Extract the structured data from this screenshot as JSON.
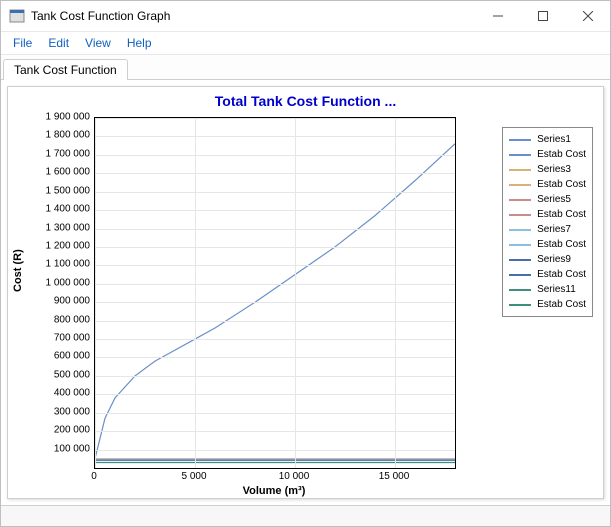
{
  "window": {
    "title": "Tank Cost Function Graph"
  },
  "menubar": {
    "file": "File",
    "edit": "Edit",
    "view": "View",
    "help": "Help"
  },
  "tabs": [
    {
      "label": "Tank Cost Function"
    }
  ],
  "chart_data": {
    "type": "line",
    "title": "Total Tank Cost Function ...",
    "xlabel": "Volume (m³)",
    "ylabel": "Cost (R)",
    "xlim": [
      0,
      18000
    ],
    "ylim": [
      0,
      1900000
    ],
    "xticks": [
      0,
      5000,
      10000,
      15000
    ],
    "xtick_labels": [
      "0",
      "5 000",
      "10 000",
      "15 000"
    ],
    "yticks": [
      100000,
      200000,
      300000,
      400000,
      500000,
      600000,
      700000,
      800000,
      900000,
      1000000,
      1100000,
      1200000,
      1300000,
      1400000,
      1500000,
      1600000,
      1700000,
      1800000,
      1900000
    ],
    "ytick_labels": [
      "100 000",
      "200 000",
      "300 000",
      "400 000",
      "500 000",
      "600 000",
      "700 000",
      "800 000",
      "900 000",
      "1 000 000",
      "1 100 000",
      "1 200 000",
      "1 300 000",
      "1 400 000",
      "1 500 000",
      "1 600 000",
      "1 700 000",
      "1 800 000",
      "1 900 000"
    ],
    "legend": [
      {
        "name": "Series1",
        "color": "#6a8fc8"
      },
      {
        "name": "Estab Cost",
        "color": "#6a8fc8"
      },
      {
        "name": "Series3",
        "color": "#d9b27a"
      },
      {
        "name": "Estab Cost",
        "color": "#d9b27a"
      },
      {
        "name": "Series5",
        "color": "#cc8b8b"
      },
      {
        "name": "Estab Cost",
        "color": "#cc8b8b"
      },
      {
        "name": "Series7",
        "color": "#8fbfe0"
      },
      {
        "name": "Estab Cost",
        "color": "#8fbfe0"
      },
      {
        "name": "Series9",
        "color": "#4a6fa6"
      },
      {
        "name": "Estab Cost",
        "color": "#4a6fa6"
      },
      {
        "name": "Series11",
        "color": "#3f8f7f"
      },
      {
        "name": "Estab Cost",
        "color": "#3f8f7f"
      }
    ],
    "series": [
      {
        "name": "Series1",
        "color": "#6a8fc8",
        "x": [
          0,
          500,
          1000,
          2000,
          3000,
          4000,
          5000,
          6000,
          8000,
          10000,
          12000,
          14000,
          16000,
          18000
        ],
        "y": [
          50000,
          270000,
          380000,
          500000,
          580000,
          640000,
          700000,
          760000,
          900000,
          1050000,
          1200000,
          1370000,
          1560000,
          1760000
        ]
      },
      {
        "name": "Estab Cost",
        "color": "#6a8fc8",
        "x": [
          0,
          18000
        ],
        "y": [
          50000,
          50000
        ]
      },
      {
        "name": "Estab Cost",
        "color": "#d9b27a",
        "x": [
          0,
          18000
        ],
        "y": [
          48000,
          48000
        ]
      },
      {
        "name": "Estab Cost",
        "color": "#cc8b8b",
        "x": [
          0,
          18000
        ],
        "y": [
          46000,
          46000
        ]
      },
      {
        "name": "Estab Cost",
        "color": "#8fbfe0",
        "x": [
          0,
          18000
        ],
        "y": [
          44000,
          44000
        ]
      },
      {
        "name": "Estab Cost",
        "color": "#4a6fa6",
        "x": [
          0,
          18000
        ],
        "y": [
          42000,
          42000
        ]
      },
      {
        "name": "Estab Cost",
        "color": "#3f8f7f",
        "x": [
          0,
          18000
        ],
        "y": [
          30000,
          30000
        ]
      }
    ]
  }
}
